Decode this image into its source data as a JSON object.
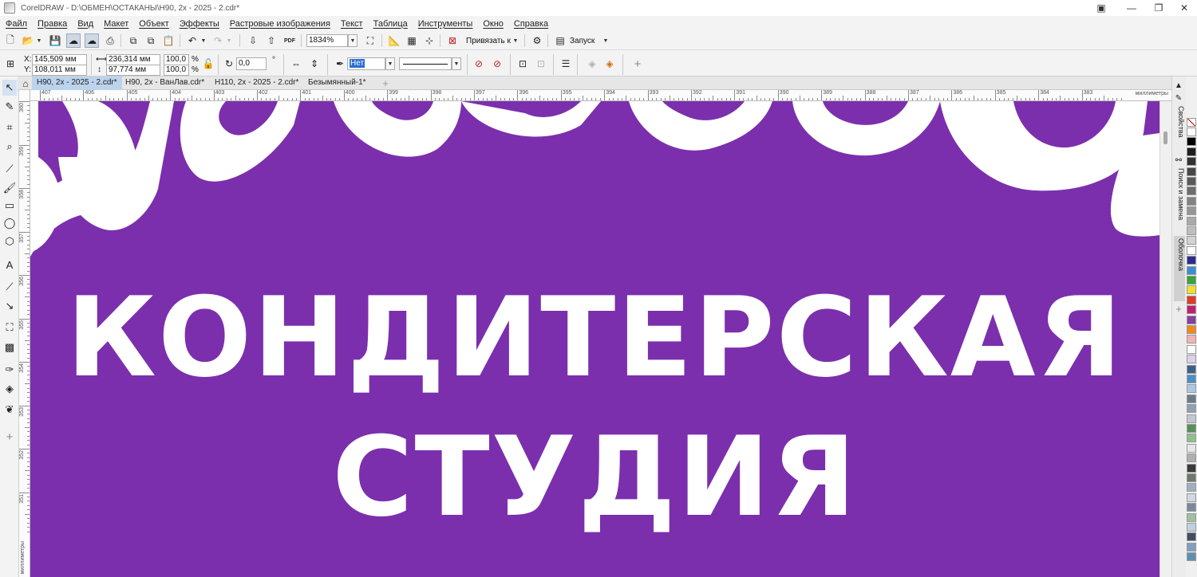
{
  "window": {
    "title": "CorelDRAW - D:\\ОБМЕН\\ОСТАКАНЫ\\Н90, 2х - 2025 - 2.cdr*",
    "minimize": "—",
    "restore": "❐",
    "close": "✕"
  },
  "menu": [
    "Файл",
    "Правка",
    "Вид",
    "Макет",
    "Объект",
    "Эффекты",
    "Растровые изображения",
    "Текст",
    "Таблица",
    "Инструменты",
    "Окно",
    "Справка"
  ],
  "toolbar": {
    "zoom_value": "1834%",
    "snap_label": "Привязать к",
    "launch_label": "Запуск",
    "pdf_label": "PDF"
  },
  "properties": {
    "x_label": "X:",
    "x_value": "145,509 мм",
    "y_label": "Y:",
    "y_value": "108,011 мм",
    "width_value": "236,314 мм",
    "height_value": "97,774 мм",
    "scale_x": "100,0",
    "scale_y": "100,0",
    "percent": "%",
    "rotation_value": "0,0",
    "degree": "°",
    "outline_width": "Нет"
  },
  "tabs": [
    {
      "label": "Н90, 2х - 2025 - 2.cdr*",
      "active": true
    },
    {
      "label": "Н90, 2х - ВанЛав.cdr*",
      "active": false
    },
    {
      "label": "Н110, 2х - 2025 - 2.cdr*",
      "active": false
    },
    {
      "label": "Безымянный-1*",
      "active": false
    }
  ],
  "ruler": {
    "h_labels": [
      "407",
      "406",
      "405",
      "404",
      "403",
      "402",
      "401",
      "400",
      "399",
      "398",
      "397",
      "396",
      "395",
      "394",
      "393",
      "392",
      "391",
      "390",
      "389",
      "388",
      "387",
      "386",
      "385",
      "384",
      "383"
    ],
    "h_unit": "миллиметры",
    "v_labels": [
      "360",
      "359",
      "358",
      "357",
      "356",
      "355",
      "354",
      "353",
      "352",
      "351"
    ],
    "v_unit": "миллиметры"
  },
  "canvas": {
    "line1": "КОНДИТЕРСКАЯ",
    "line2": "СТУДИЯ",
    "background_color": "#7b2fad",
    "text_color": "#ffffff"
  },
  "dockers": [
    "Свойства",
    "Поиск и замена",
    "Оболочка"
  ],
  "palette": [
    "#ffffff",
    "#000000",
    "#1f1f1f",
    "#333333",
    "#474747",
    "#5a5a5a",
    "#6e6e6e",
    "#828282",
    "#969696",
    "#aaaaaa",
    "#bebebe",
    "#d2d2d2",
    "#ffffff",
    "#2b2b8f",
    "#3b8fd0",
    "#3aa33a",
    "#f0e12a",
    "#e03a2a",
    "#c0206f",
    "#8a3fa0",
    "#f08a1a",
    "#f3b3b3",
    "#ffffff",
    "#d9d2ea",
    "#3e5f8a",
    "#4a90c8",
    "#a9c8e6",
    "#6b7b8c",
    "#8fa0b0",
    "#c0c8d0",
    "#5a8f5a",
    "#8fbf8f",
    "#e6e6e6",
    "#b0b0b0",
    "#3b3b3b",
    "#6a7a6a",
    "#9fb0c0",
    "#d0d8e0",
    "#7a8a9a",
    "#a0c0a0",
    "#c0d0e0",
    "#405060",
    "#80a0c0",
    "#6090b0"
  ]
}
